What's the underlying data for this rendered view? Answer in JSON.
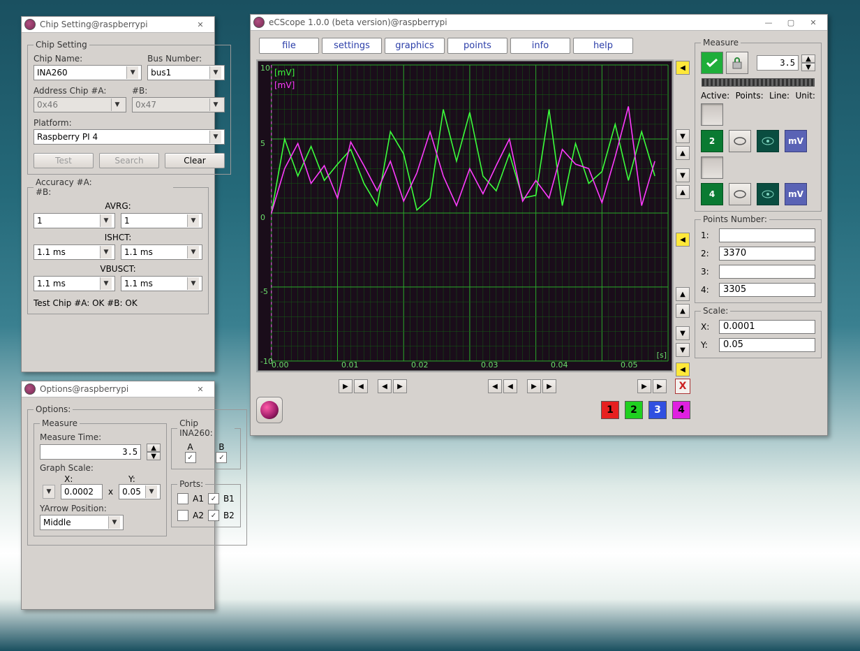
{
  "chipWin": {
    "title": "Chip Setting@raspberrypi",
    "legend": "Chip Setting",
    "chipName_lbl": "Chip Name:",
    "chipName": "INA260",
    "busNumber_lbl": "Bus Number:",
    "busNumber": "bus1",
    "addrA_lbl": "Address Chip #A:",
    "addrB_lbl": "#B:",
    "addrA": "0x46",
    "addrB": "0x47",
    "platform_lbl": "Platform:",
    "platform": "Raspberry PI 4",
    "test_btn": "Test",
    "search_btn": "Search",
    "clear_btn": "Clear",
    "accA_lbl": "Accuracy #A:",
    "accB_lbl": "#B:",
    "avrg_lbl": "AVRG:",
    "avrgA": "1",
    "avrgB": "1",
    "ishct_lbl": "ISHCT:",
    "ishctA": "1.1 ms",
    "ishctB": "1.1 ms",
    "vbusct_lbl": "VBUSCT:",
    "vbusctA": "1.1 ms",
    "vbusctB": "1.1 ms",
    "status": "Test Chip #A: OK #B: OK"
  },
  "optWin": {
    "title": "Options@raspberrypi",
    "legend": "Options:",
    "measure_leg": "Measure",
    "measureTime_lbl": "Measure Time:",
    "measureTime": "3.5",
    "graphScale_lbl": "Graph Scale:",
    "x_lbl": "X:",
    "y_lbl": "Y:",
    "xMult": "x",
    "scaleX": "0.0002",
    "scaleY": "0.05",
    "yarrow_lbl": "YArrow Position:",
    "yarrow": "Middle",
    "chip_leg": "Chip INA260:",
    "A_lbl": "A",
    "B_lbl": "B",
    "ports_leg": "Ports:",
    "A1_lbl": "A1",
    "B1_lbl": "B1",
    "A2_lbl": "A2",
    "B2_lbl": "B2"
  },
  "scope": {
    "title": "eCScope 1.0.0 (beta version)@raspberrypi",
    "menus": {
      "file": "file",
      "settings": "settings",
      "graphics": "graphics",
      "points": "points",
      "info": "info",
      "help": "help"
    },
    "measure_leg": "Measure",
    "spin_val": "3.5",
    "header": {
      "active": "Active:",
      "points": "Points:",
      "line": "Line:",
      "unit": "Unit:"
    },
    "unit_label": "mV",
    "ch2": "2",
    "ch4": "4",
    "points_leg": "Points Number:",
    "p1_lbl": "1:",
    "p1": "",
    "p2_lbl": "2:",
    "p2": "3370",
    "p3_lbl": "3:",
    "p3": "",
    "p4_lbl": "4:",
    "p4": "3305",
    "scale_leg": "Scale:",
    "sx_lbl": "X:",
    "sx": "0.0001",
    "sy_lbl": "Y:",
    "sy": "0.05",
    "chan1": "1",
    "chan2": "2",
    "chan3": "3",
    "chan4": "4",
    "x_btn": "X",
    "yticks": {
      "p10": "10",
      "p5": "5",
      "z": "0",
      "n5": "-5",
      "n10": "-10"
    },
    "xticks": {
      "t0": "0.00",
      "t1": "0.01",
      "t2": "0.02",
      "t3": "0.03",
      "t4": "0.04",
      "t5": "0.05"
    },
    "s_unit": "[s]",
    "mv1": "[mV]",
    "mv2": "[mV]"
  },
  "chart_data": {
    "type": "line",
    "title": "",
    "xlabel": "[s]",
    "ylabel": "[mV]",
    "xlim": [
      0.0,
      0.06
    ],
    "ylim": [
      -10,
      10
    ],
    "x": [
      0.0,
      0.002,
      0.004,
      0.006,
      0.008,
      0.01,
      0.012,
      0.014,
      0.016,
      0.018,
      0.02,
      0.022,
      0.024,
      0.026,
      0.028,
      0.03,
      0.032,
      0.034,
      0.036,
      0.038,
      0.04,
      0.042,
      0.044,
      0.046,
      0.048,
      0.05,
      0.052,
      0.054,
      0.056,
      0.058
    ],
    "series": [
      {
        "name": "channel-2",
        "color": "#3cff3c",
        "unit": "mV",
        "values": [
          0.0,
          5.0,
          2.5,
          4.5,
          2.2,
          3.3,
          4.3,
          2.0,
          0.5,
          5.5,
          4.0,
          0.2,
          1.0,
          7.0,
          3.5,
          6.8,
          2.5,
          1.5,
          4.0,
          1.0,
          1.2,
          7.0,
          0.5,
          4.7,
          2.0,
          2.8,
          6.0,
          2.2,
          5.5,
          2.5
        ]
      },
      {
        "name": "channel-4",
        "color": "#ff3cff",
        "unit": "mV",
        "values": [
          0.0,
          3.0,
          4.7,
          2.0,
          3.2,
          1.0,
          4.8,
          3.2,
          1.5,
          3.5,
          0.8,
          2.7,
          5.5,
          2.5,
          0.5,
          3.0,
          1.3,
          3.2,
          5.0,
          0.8,
          2.2,
          1.0,
          4.3,
          3.3,
          3.0,
          0.7,
          3.8,
          7.2,
          0.5,
          3.5
        ]
      }
    ],
    "grid": true
  }
}
